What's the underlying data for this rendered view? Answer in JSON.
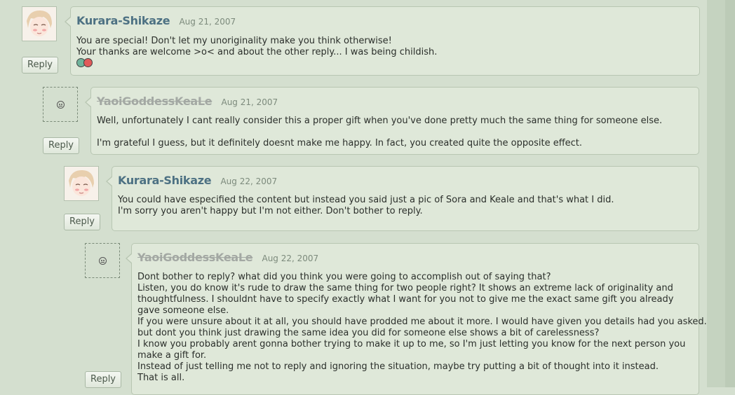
{
  "reply_label": "Reply",
  "comments": [
    {
      "author": "Kurara-Shikaze",
      "date": "Aug 21, 2007",
      "lines": [
        "You are special! Don't let my unoriginality make you think otherwise!",
        "Your thanks are welcome >o< and about the other reply... I was being childish."
      ]
    },
    {
      "author": "YaoiGoddessKeaLe",
      "date": "Aug 21, 2007",
      "lines": [
        "Well, unfortunately I cant really consider this a proper gift when you've done pretty much the same thing for someone else.",
        "I'm grateful I guess, but it definitely doesnt make me happy. In fact, you created quite the opposite effect."
      ]
    },
    {
      "author": "Kurara-Shikaze",
      "date": "Aug 22, 2007",
      "lines": [
        "You could have especified the content but instead you said just a pic of Sora and Keale and that's what I did.",
        "I'm sorry you aren't happy but I'm not either. Don't bother to reply."
      ]
    },
    {
      "author": "YaoiGoddessKeaLe",
      "date": "Aug 22, 2007",
      "lines": [
        "Dont bother to reply? what did you think you were going to accomplish out of saying that?",
        "Listen, you do know it's rude to draw the same thing for two people right? It shows an extreme lack of originality and thoughtfulness. I shouldnt have to specify exactly what I want for you not to give me the exact same gift you already gave someone else.",
        "If you were unsure about it at all, you should have prodded me about it more. I would have given you details had you asked.",
        "but dont you think just drawing the same idea you did for someone else shows a bit of carelessness?",
        "I know you probably arent gonna bother trying to make it up to me, so I'm just letting you know for the next person you make a gift for.",
        "Instead of just telling me not to reply and ignoring the situation, maybe try putting a bit of thought into it instead.",
        "That is all."
      ]
    }
  ]
}
